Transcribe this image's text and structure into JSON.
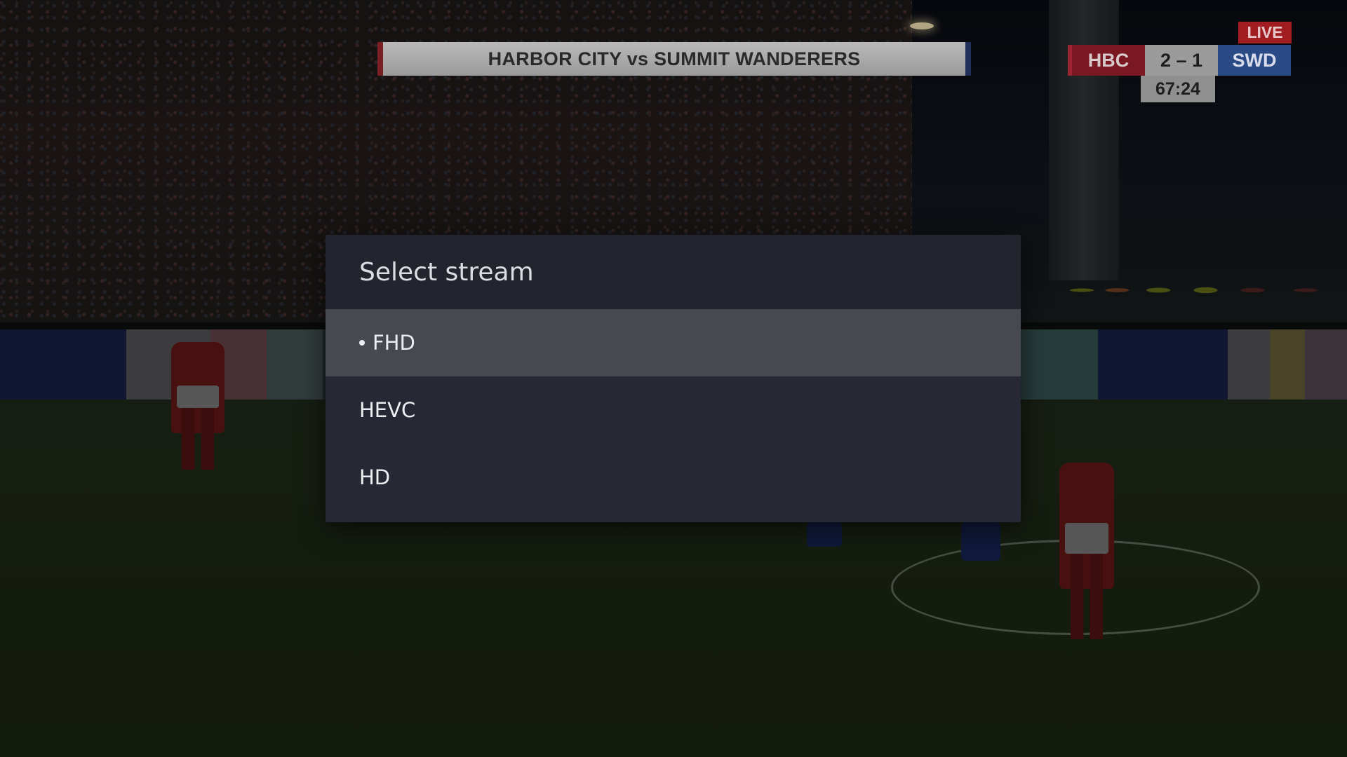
{
  "broadcast": {
    "match_title": "HARBOR CITY vs SUMMIT WANDERERS",
    "home_team": "HBC",
    "score": "2 – 1",
    "away_team": "SWD",
    "match_clock": "67:24",
    "live_label": "LIVE"
  },
  "dialog": {
    "title": "Select stream",
    "options": [
      {
        "label": "FHD",
        "selected": true,
        "focused": true
      },
      {
        "label": "HEVC",
        "selected": false,
        "focused": false
      },
      {
        "label": "HD",
        "selected": false,
        "focused": false
      }
    ]
  },
  "colors": {
    "dialog_background": "#262833",
    "focused_row": "#474951",
    "home_team": "#7a1822",
    "away_team": "#2a4a86",
    "live_badge": "#a11d22"
  }
}
